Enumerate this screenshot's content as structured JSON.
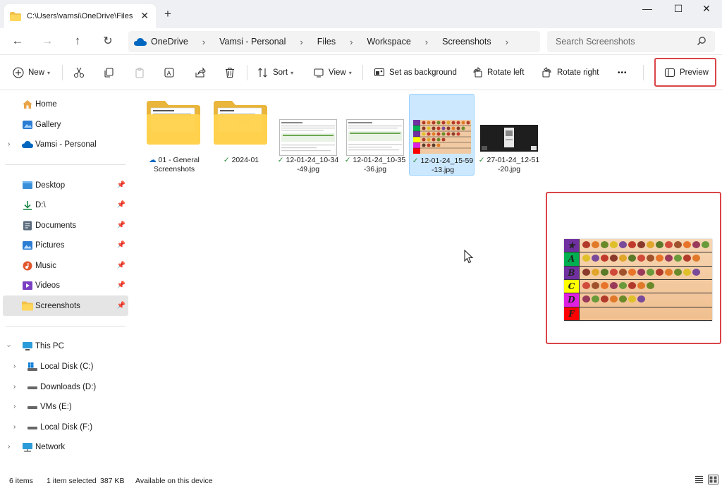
{
  "titlebar": {
    "tab_title": "C:\\Users\\vamsi\\OneDrive\\Files",
    "close_tab": "✕",
    "new_tab": "+",
    "minimize": "—",
    "maximize": "☐",
    "close": "✕"
  },
  "address": {
    "breadcrumbs": [
      "OneDrive",
      "Vamsi - Personal",
      "Files",
      "Workspace",
      "Screenshots"
    ],
    "search_placeholder": "Search Screenshots"
  },
  "toolbar": {
    "new_label": "New",
    "sort_label": "Sort",
    "view_label": "View",
    "set_background_label": "Set as background",
    "rotate_left_label": "Rotate left",
    "rotate_right_label": "Rotate right",
    "more_label": "•••",
    "preview_label": "Preview"
  },
  "sidebar": {
    "home": "Home",
    "gallery": "Gallery",
    "vamsi": "Vamsi - Personal",
    "desktop": "Desktop",
    "d_drive": "D:\\",
    "documents": "Documents",
    "pictures": "Pictures",
    "music": "Music",
    "videos": "Videos",
    "screenshots": "Screenshots",
    "this_pc": "This PC",
    "local_c": "Local Disk (C:)",
    "downloads_d": "Downloads (D:)",
    "vms_e": "VMs (E:)",
    "local_f": "Local Disk (F:)",
    "network": "Network"
  },
  "files": {
    "f1_line1": "01 - General",
    "f1_line2": "Screenshots",
    "f2": "2024-01",
    "f3_line1": "12-01-24_10-34",
    "f3_line2": "-49.jpg",
    "f4_line1": "12-01-24_10-35",
    "f4_line2": "-36.jpg",
    "f5_line1": "12-01-24_15-59",
    "f5_line2": "-13.jpg",
    "f6_line1": "27-01-24_12-51",
    "f6_line2": "-20.jpg"
  },
  "tiers": [
    "★",
    "A",
    "B",
    "C",
    "D",
    "F"
  ],
  "tier_colors": [
    "#7030a0",
    "#00b050",
    "#7030a0",
    "#ffff00",
    "#e020e0",
    "#ff0000"
  ],
  "status": {
    "items": "6 items",
    "selected": "1 item selected",
    "size": "387 KB",
    "availability": "Available on this device"
  },
  "colors": {
    "accent": "#0067c0",
    "highlight_border": "#d94548",
    "selection": "#cce8ff"
  }
}
